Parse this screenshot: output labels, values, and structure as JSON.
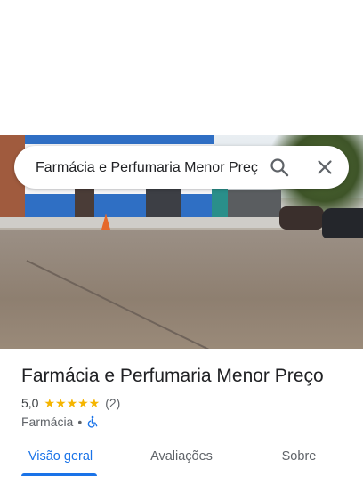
{
  "search": {
    "value": "Farmácia e Perfumaria Menor Preço",
    "search_icon": "search-icon",
    "close_icon": "close-icon"
  },
  "place": {
    "name": "Farmácia e Perfumaria Menor Preço",
    "rating": "5,0",
    "stars": "★★★★★",
    "review_count": "(2)",
    "category": "Farmácia",
    "separator": "•",
    "accessibility_icon": "wheelchair-icon"
  },
  "tabs": [
    {
      "label": "Visão geral",
      "active": true
    },
    {
      "label": "Avaliações",
      "active": false
    },
    {
      "label": "Sobre",
      "active": false
    }
  ],
  "colors": {
    "accent": "#1a73e8",
    "star": "#f5b500",
    "text_primary": "#202124",
    "text_secondary": "#5f6368"
  }
}
